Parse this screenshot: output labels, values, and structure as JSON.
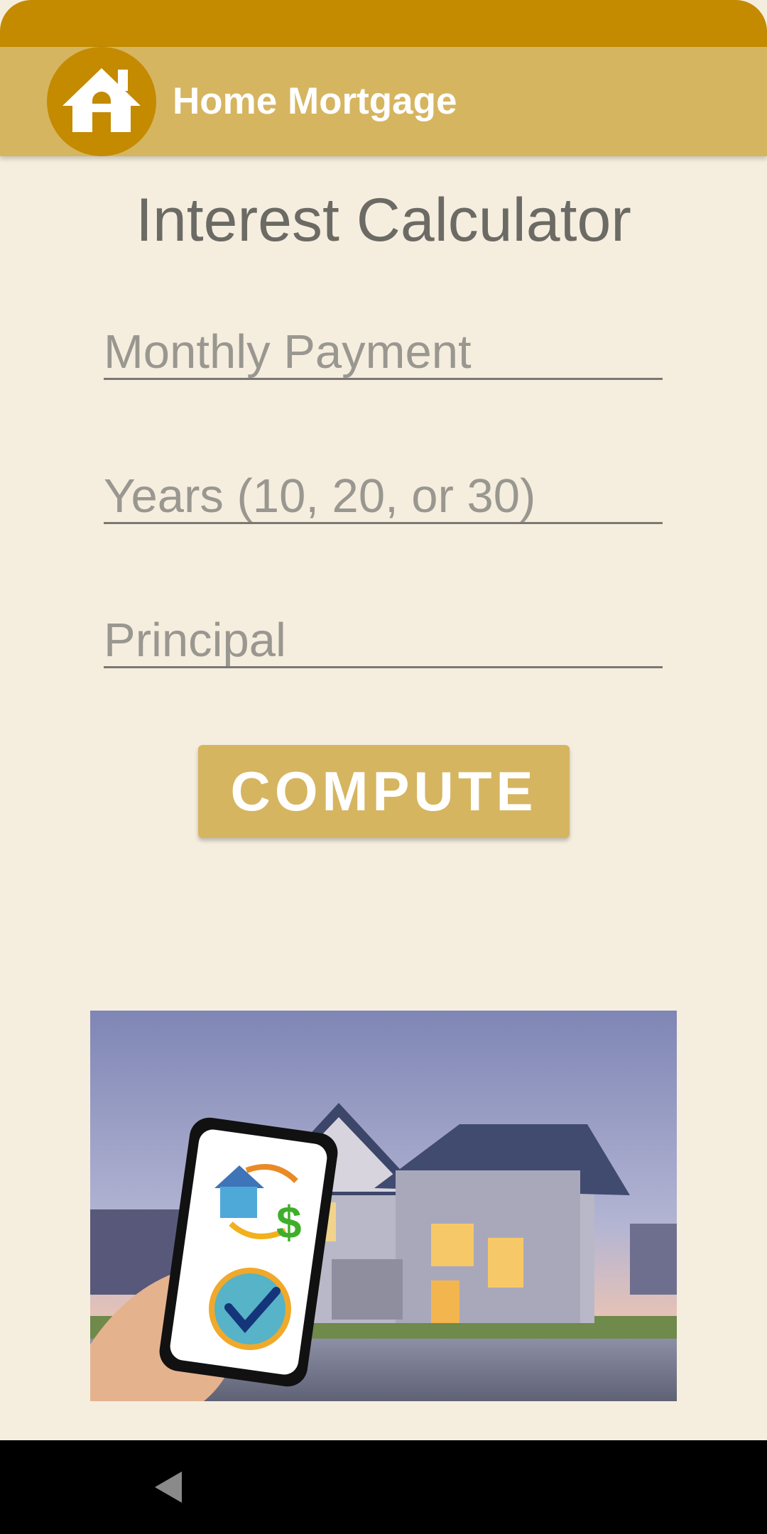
{
  "app_bar": {
    "title": "Home Mortgage",
    "logo_icon": "home-icon"
  },
  "main": {
    "title": "Interest Calculator",
    "fields": [
      {
        "placeholder": "Monthly Payment",
        "value": ""
      },
      {
        "placeholder": "Years (10, 20, or 30)",
        "value": ""
      },
      {
        "placeholder": "Principal",
        "value": ""
      }
    ],
    "compute_label": "COMPUTE"
  },
  "image": {
    "icons": [
      "house-icon",
      "dollar-sign-icon",
      "checkmark-icon"
    ]
  },
  "nav_bar": {
    "back_icon": "back-triangle-icon"
  },
  "colors": {
    "status_bar": "#c48a00",
    "app_bar": "#d6b560",
    "background": "#f5eedf",
    "button": "#d6b560"
  }
}
